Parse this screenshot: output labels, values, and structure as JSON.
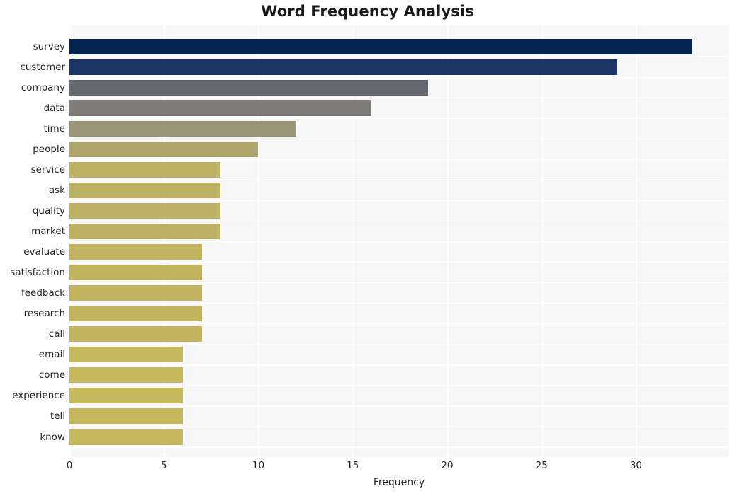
{
  "chart_data": {
    "type": "bar",
    "orientation": "horizontal",
    "title": "Word Frequency Analysis",
    "xlabel": "Frequency",
    "ylabel": "",
    "categories": [
      "survey",
      "customer",
      "company",
      "data",
      "time",
      "people",
      "service",
      "ask",
      "quality",
      "market",
      "evaluate",
      "satisfaction",
      "feedback",
      "research",
      "call",
      "email",
      "come",
      "experience",
      "tell",
      "know"
    ],
    "values": [
      33,
      29,
      19,
      16,
      12,
      10,
      8,
      8,
      8,
      8,
      7,
      7,
      7,
      7,
      7,
      6,
      6,
      6,
      6,
      6
    ],
    "bar_colors": [
      "#05244f",
      "#1c3667",
      "#686a72",
      "#7d7c78",
      "#9c9478",
      "#aea66e",
      "#bdb163",
      "#bdb163",
      "#bdb163",
      "#bdb163",
      "#c2b45f",
      "#c2b45f",
      "#c2b45f",
      "#c2b45f",
      "#c2b45f",
      "#c6b85c",
      "#c6b85c",
      "#c6b85c",
      "#c6b85c",
      "#c6b85c"
    ],
    "xticks": [
      0,
      5,
      10,
      15,
      20,
      25,
      30
    ],
    "xlim": [
      0,
      34.9
    ],
    "grid": true,
    "grid_color": "#ffffff",
    "plot_background": "#f7f7f7",
    "figure_background": "#ffffff",
    "legend": null
  }
}
